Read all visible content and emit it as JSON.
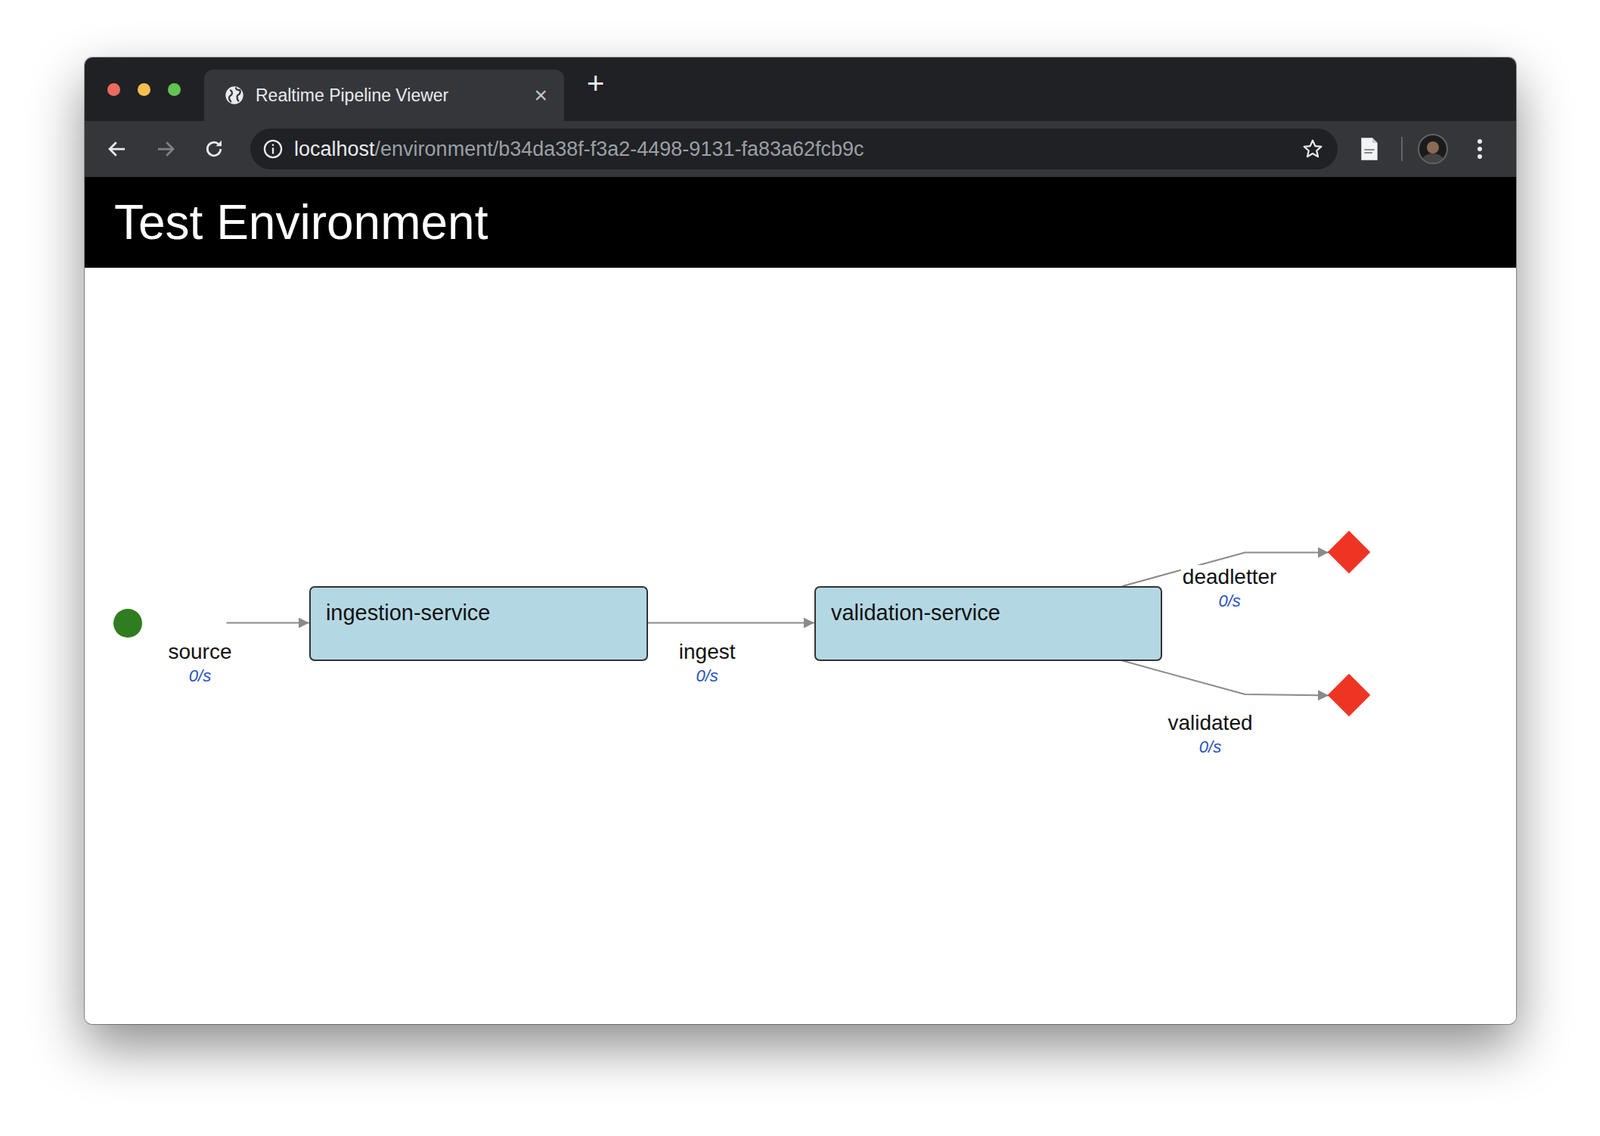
{
  "window": {
    "title": "Realtime Pipeline Viewer",
    "close": "×",
    "new_tab": "+"
  },
  "toolbar": {
    "back_enabled": true,
    "forward_enabled": false
  },
  "address_bar": {
    "host": "localhost",
    "path": "/environment/b34da38f-f3a2-4498-9131-fa83a62fcb9c"
  },
  "header": {
    "title": "Test Environment"
  },
  "diagram": {
    "nodes": [
      {
        "kind": "source",
        "color": "#2f7d20"
      },
      {
        "kind": "service",
        "label": "ingestion-service"
      },
      {
        "kind": "service",
        "label": "validation-service"
      },
      {
        "kind": "sink",
        "color": "#ee3524"
      },
      {
        "kind": "sink",
        "color": "#ee3524"
      }
    ],
    "edges": [
      {
        "label": "source",
        "rate": "0/s"
      },
      {
        "label": "ingest",
        "rate": "0/s"
      },
      {
        "label": "deadletter",
        "rate": "0/s"
      },
      {
        "label": "validated",
        "rate": "0/s"
      }
    ]
  }
}
